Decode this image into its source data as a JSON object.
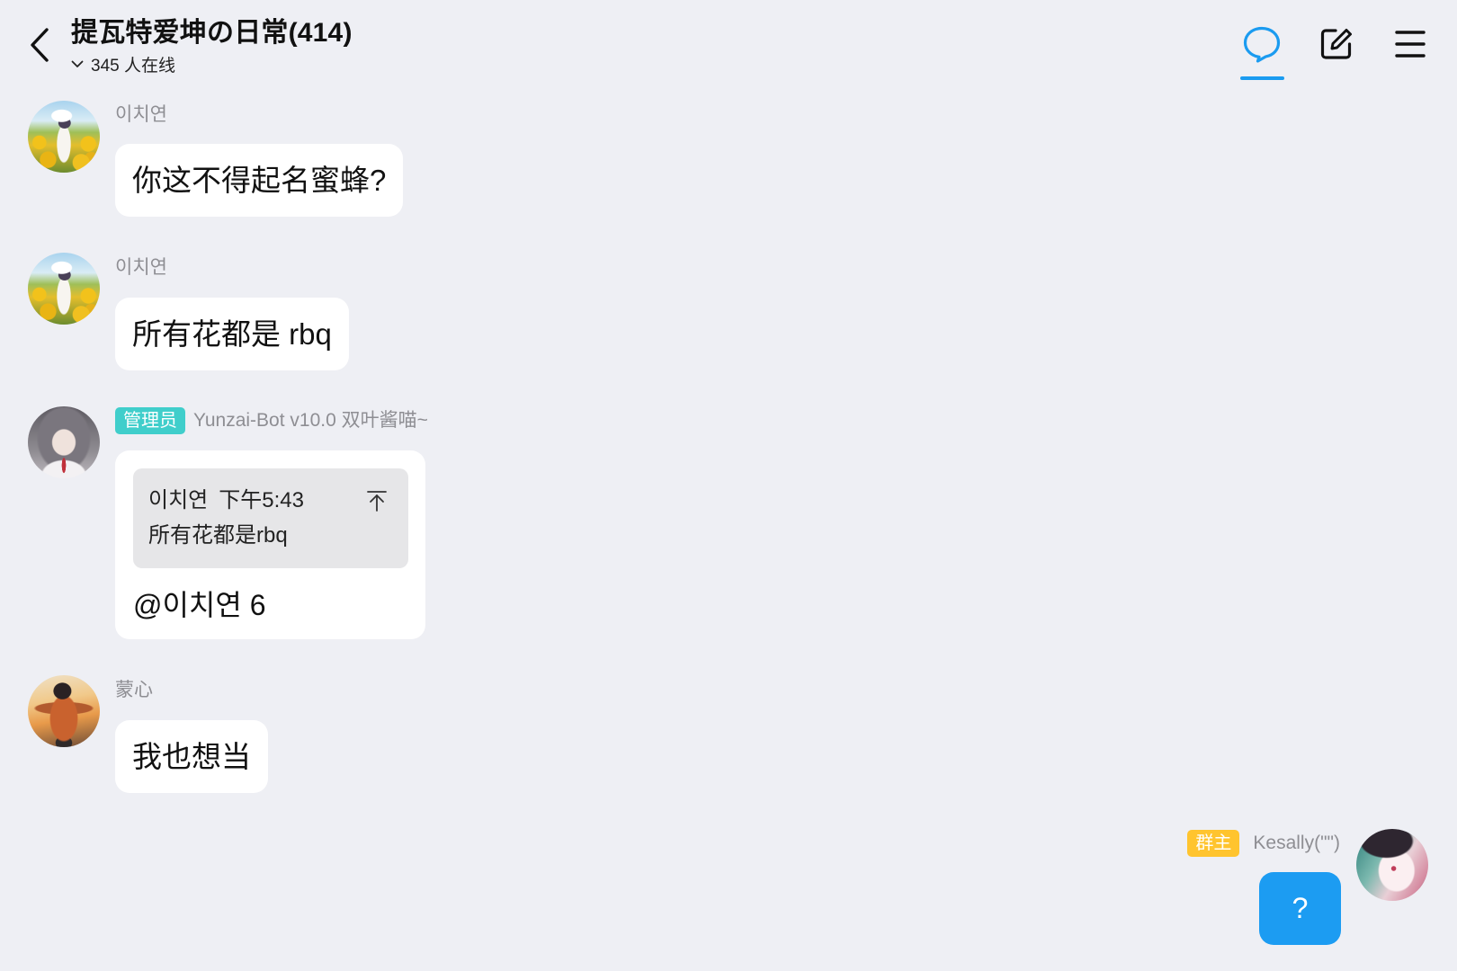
{
  "header": {
    "back_icon": "chevron-left-icon",
    "title": "提瓦特爱坤の日常(414)",
    "expand_icon": "chevron-down-icon",
    "online_count": "345 人在线",
    "actions": [
      {
        "icon": "chat-bubble-icon",
        "active": true
      },
      {
        "icon": "edit-icon",
        "active": false
      },
      {
        "icon": "menu-icon",
        "active": false
      }
    ]
  },
  "colors": {
    "background": "#eeeff4",
    "accent": "#1a9bf0",
    "bubble": "#ffffff",
    "self_bubble": "#1c9cf2",
    "quote_bg": "#e6e6e8",
    "admin_badge": "#40cecb",
    "owner_badge": "#ffc42e"
  },
  "messages": [
    {
      "sender": "이치연",
      "text": "你这不得起名蜜蜂?"
    },
    {
      "sender": "이치연",
      "text": "所有花都是 rbq"
    },
    {
      "badge": "管理员",
      "sender": "Yunzai-Bot v10.0 双叶酱喵~",
      "quote": {
        "sender": "이치연",
        "time": "下午5:43",
        "text": "所有花都是rbq",
        "jump_icon": "jump-to-message-icon"
      },
      "text": "@이치연 6"
    },
    {
      "sender": "蒙心",
      "text": "我也想当"
    },
    {
      "badge": "群主",
      "sender": "Kesally(\"\")",
      "text": "?",
      "self": true
    }
  ]
}
